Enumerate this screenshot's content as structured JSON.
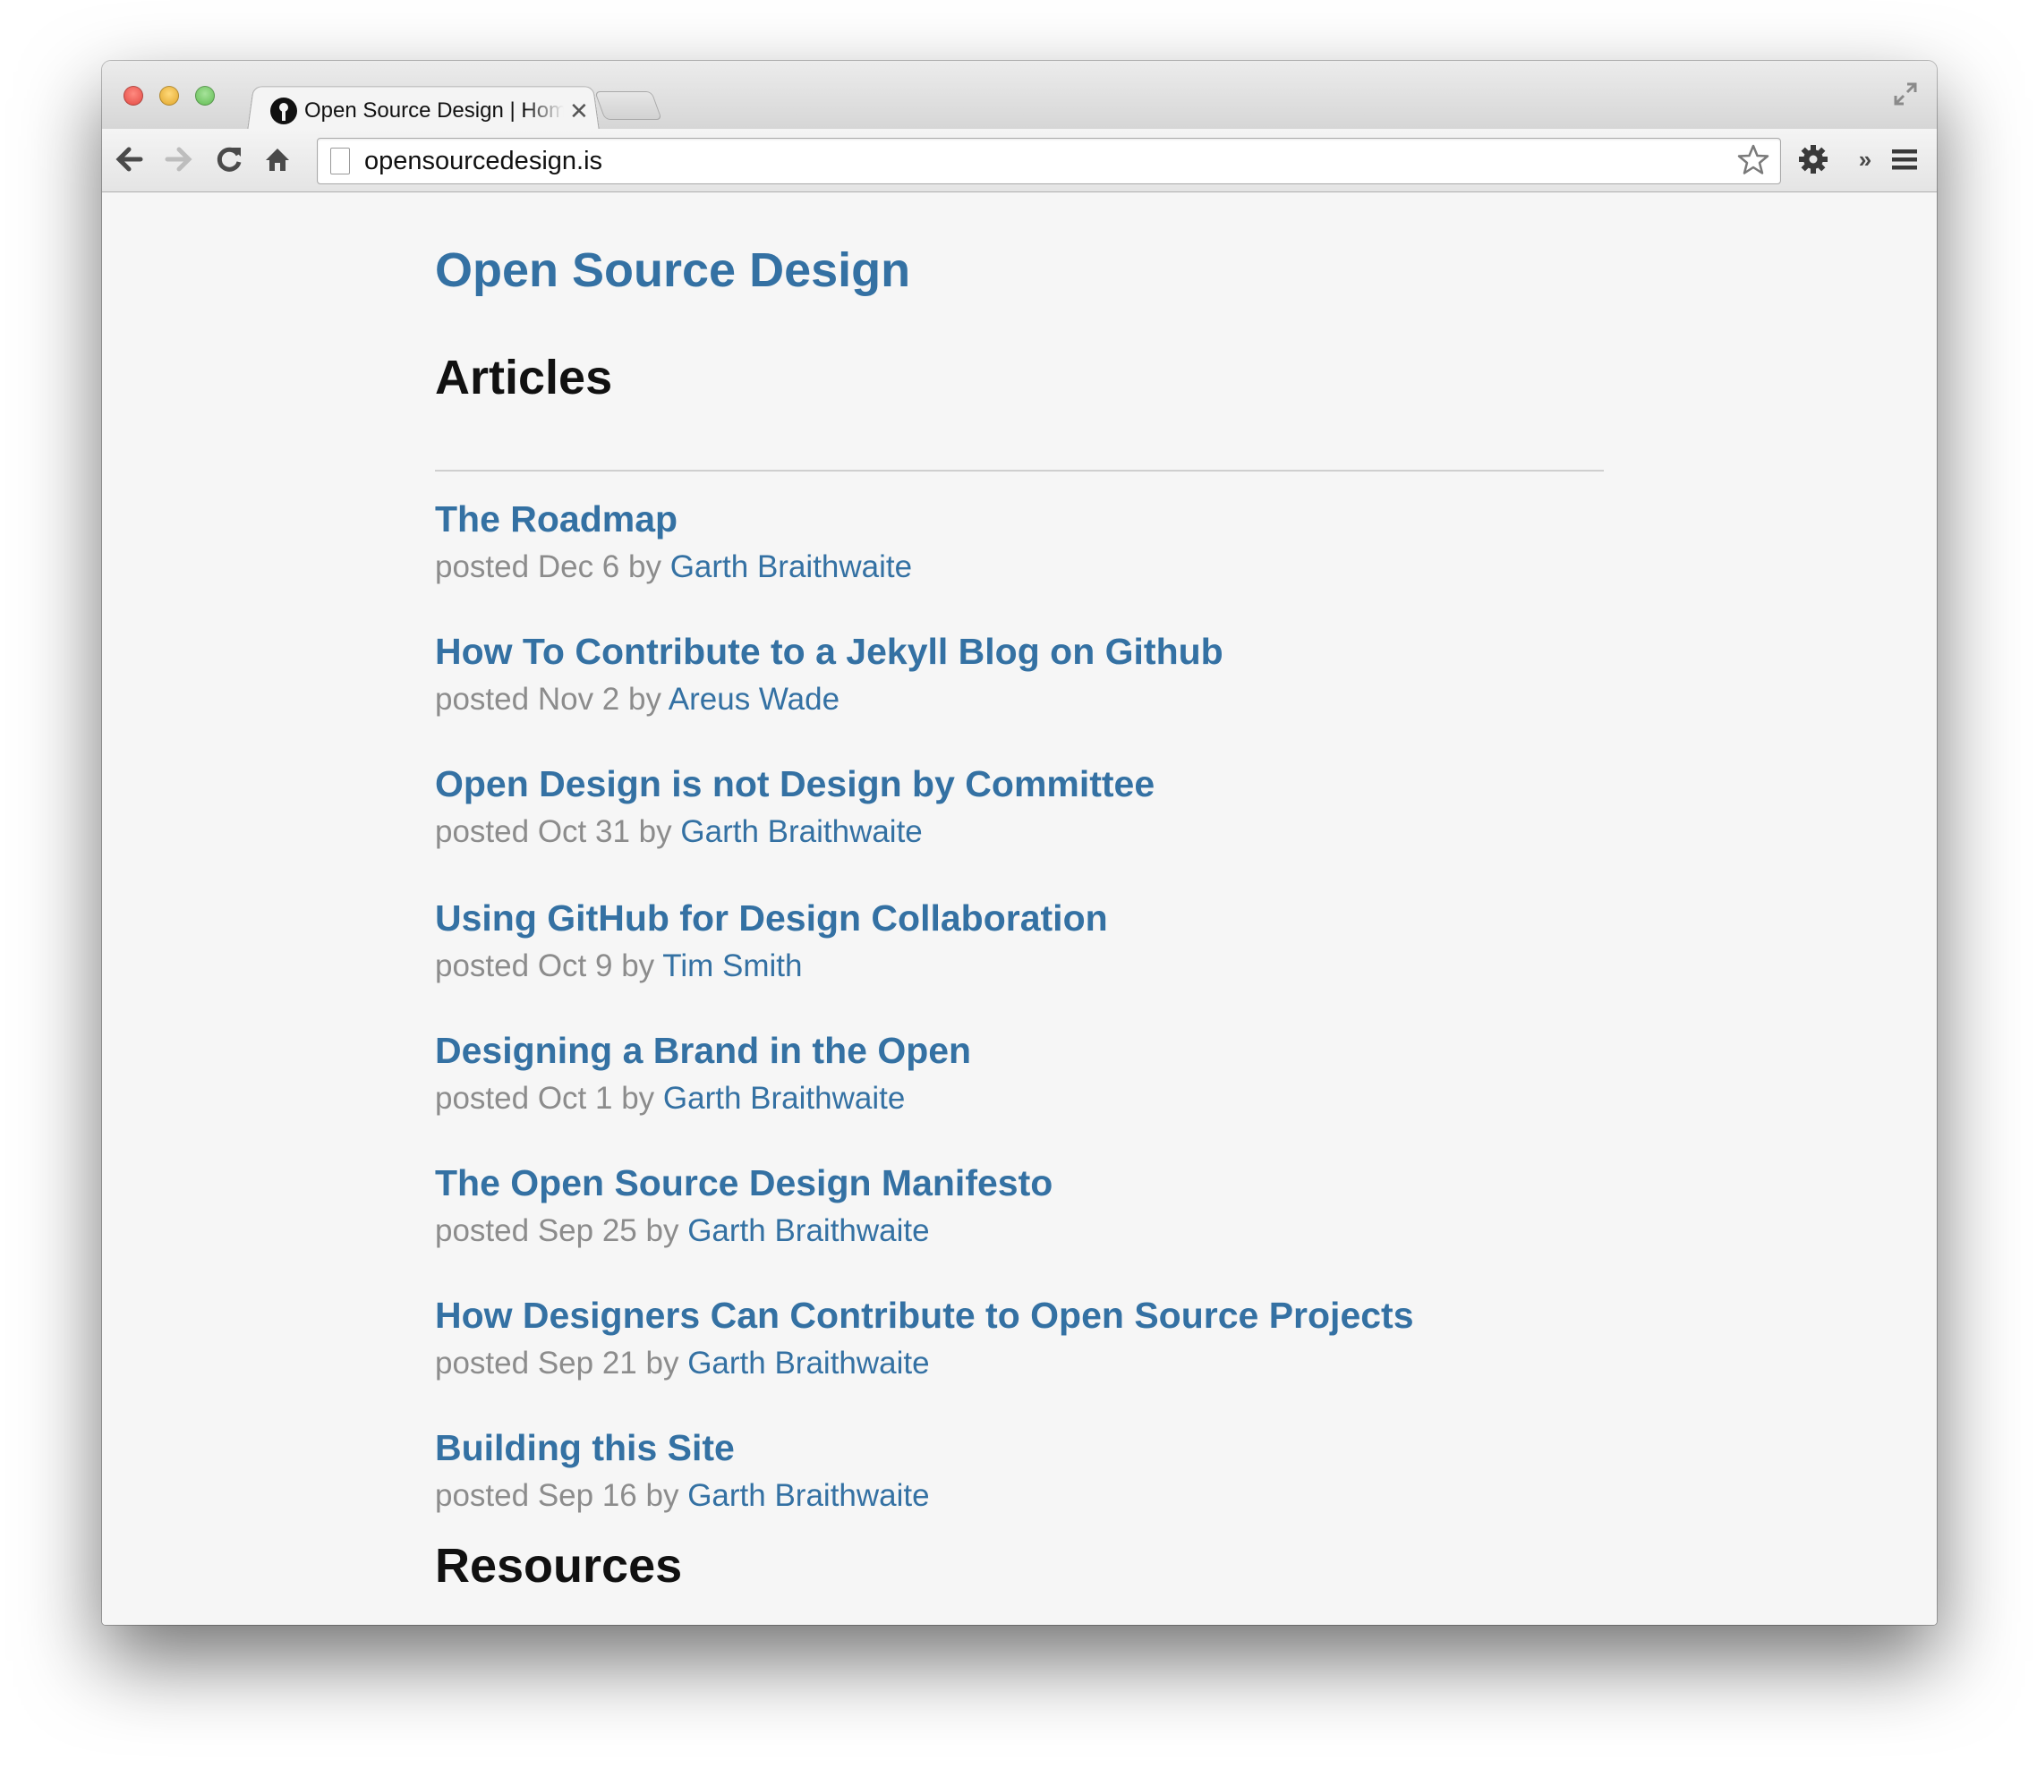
{
  "browser": {
    "tab_title": "Open Source Design | Home",
    "tab_close": "✕",
    "url": "opensourcedesign.is"
  },
  "page": {
    "site_title": "Open Source Design",
    "articles_heading": "Articles",
    "resources_heading": "Resources",
    "posted_prefix": "posted",
    "by_word": "by",
    "articles": [
      {
        "title": "The Roadmap",
        "date": "Dec 6",
        "author": "Garth Braithwaite"
      },
      {
        "title": "How To Contribute to a Jekyll Blog on Github",
        "date": "Nov 2",
        "author": "Areus Wade"
      },
      {
        "title": "Open Design is not Design by Committee",
        "date": "Oct 31",
        "author": "Garth Braithwaite"
      },
      {
        "title": "Using GitHub for Design Collaboration",
        "date": "Oct 9",
        "author": "Tim Smith"
      },
      {
        "title": "Designing a Brand in the Open",
        "date": "Oct 1",
        "author": "Garth Braithwaite"
      },
      {
        "title": "The Open Source Design Manifesto",
        "date": "Sep 25",
        "author": "Garth Braithwaite"
      },
      {
        "title": "How Designers Can Contribute to Open Source Projects",
        "date": "Sep 21",
        "author": "Garth Braithwaite"
      },
      {
        "title": "Building this Site",
        "date": "Sep 16",
        "author": "Garth Braithwaite"
      }
    ]
  },
  "icons": {
    "back": "back-arrow-icon",
    "forward": "forward-arrow-icon",
    "reload": "reload-icon",
    "home": "home-icon",
    "page": "page-icon",
    "star": "bookmark-star-icon",
    "settings": "gear-icon",
    "overflow": "chevron-double-right-icon",
    "menu": "hamburger-menu-icon",
    "fullscreen": "fullscreen-icon"
  },
  "colors": {
    "link": "#3471a3",
    "meta": "#8c8c8c",
    "heading": "#111111",
    "page_bg": "#f6f6f6"
  }
}
